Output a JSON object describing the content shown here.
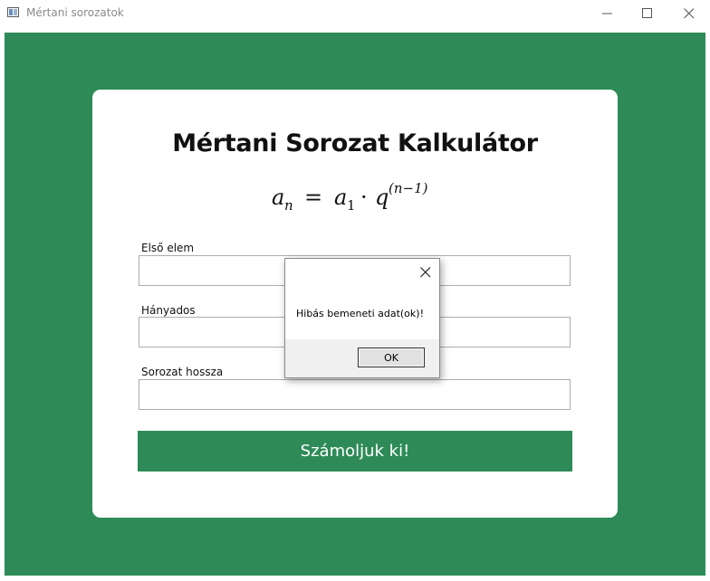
{
  "window": {
    "title": "Mértani sorozatok"
  },
  "card": {
    "title": "Mértani Sorozat Kalkulátor",
    "formula": {
      "lhs": "a",
      "lhs_sub": "n",
      "equals": "=",
      "rhs_a": "a",
      "rhs_a_sub": "1",
      "dot": "·",
      "rhs_q": "q",
      "rhs_q_sup": "(n−1)"
    }
  },
  "form": {
    "fields": [
      {
        "label": "Első elem",
        "value": "",
        "placeholder": ""
      },
      {
        "label": "Hányados",
        "value": "",
        "placeholder": ""
      },
      {
        "label": "Sorozat hossza",
        "value": "",
        "placeholder": ""
      }
    ],
    "submit_label": "Számoljuk ki!"
  },
  "dialog": {
    "message": "Hibás bemeneti adat(ok)!",
    "ok_label": "OK"
  },
  "colors": {
    "accent": "#2e8b57",
    "card_background": "#ffffff",
    "dialog_footer": "#f0f0f0"
  }
}
